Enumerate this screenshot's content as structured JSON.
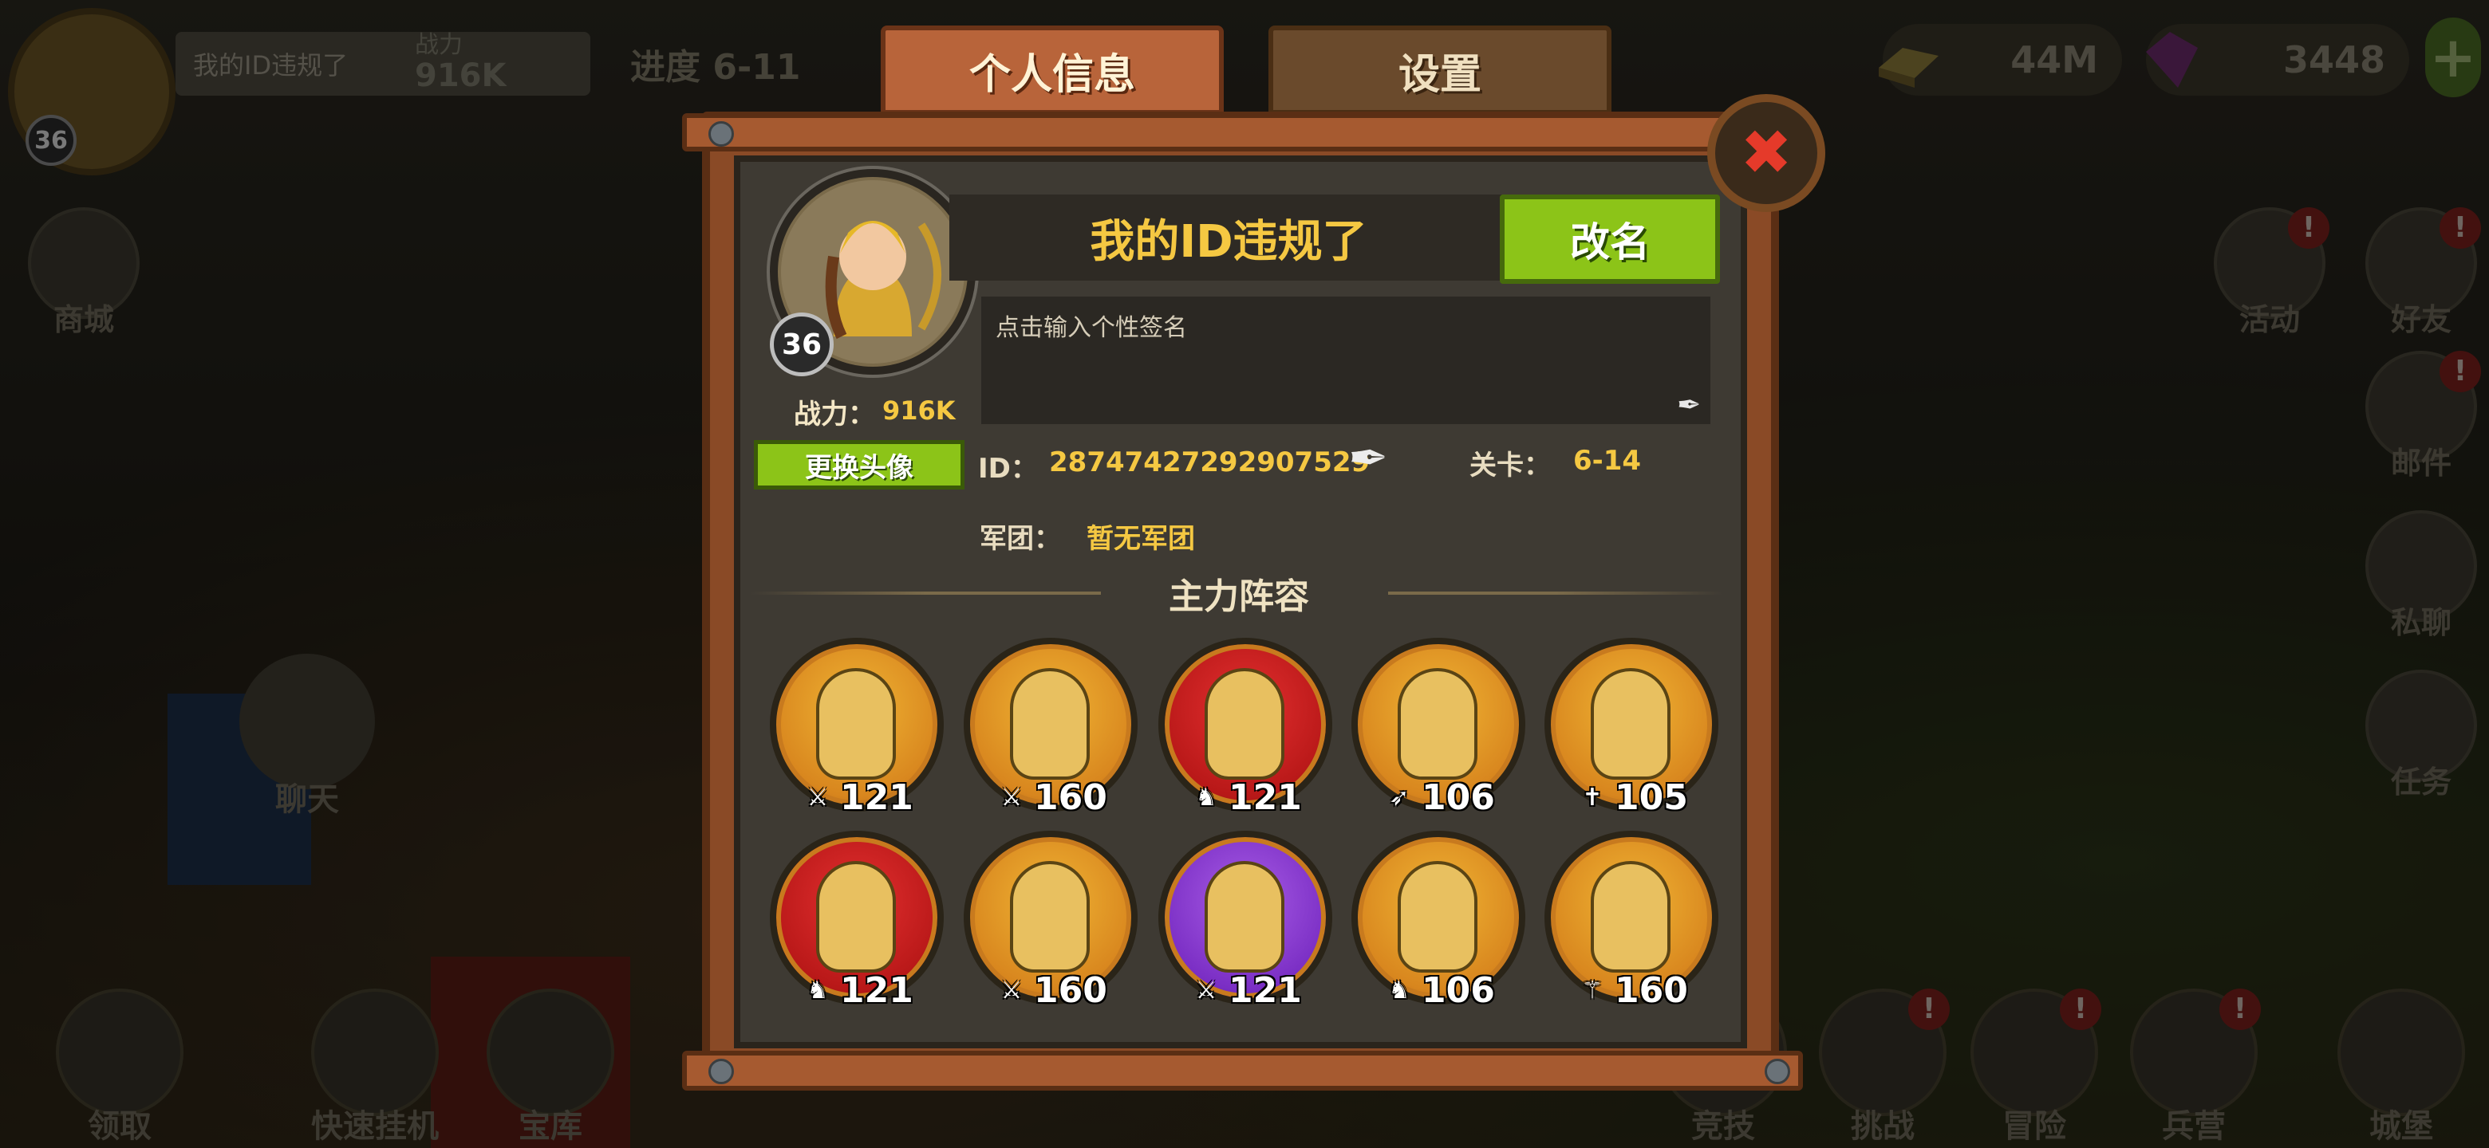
{
  "hud": {
    "player_name": "我的ID违规了",
    "player_level": "36",
    "power_label": "战力",
    "power_value": "916K",
    "progress_label": "进度",
    "progress_value": "6-11",
    "gold": "44M",
    "gems": "3448",
    "plus": "+"
  },
  "left_buttons": {
    "shop": "商城",
    "chat": "聊天",
    "claim": "领取",
    "quick_idle": "快速挂机",
    "treasury": "宝库"
  },
  "right_buttons": {
    "activity": "活动",
    "friends": "好友",
    "mail": "邮件",
    "pm": "私聊",
    "tasks": "任务",
    "badge": "!"
  },
  "bottom_buttons": {
    "arena": "竞技",
    "challenge": "挑战",
    "adventure": "冒险",
    "barracks": "兵营",
    "castle": "城堡"
  },
  "tabs": {
    "profile": "个人信息",
    "settings": "设置"
  },
  "close_icon": "✖",
  "profile": {
    "name": "我的ID违规了",
    "level": "36",
    "rename_button": "改名",
    "signature_placeholder": "点击输入个性签名",
    "power_label": "战力：",
    "power_value": "916K",
    "change_avatar_button": "更换头像",
    "id_label": "ID：",
    "id_value": "2874742729290752­9",
    "stage_label": "关卡：",
    "stage_value": "6-14",
    "legion_label": "军团：",
    "legion_value": "暂无军团"
  },
  "lineup": {
    "title": "主力阵容",
    "heroes": [
      {
        "frame": "gold",
        "class_icon": "sword-icon",
        "level": "121"
      },
      {
        "frame": "gold",
        "class_icon": "sword-icon",
        "level": "160"
      },
      {
        "frame": "red",
        "class_icon": "horse-icon",
        "level": "121"
      },
      {
        "frame": "gold",
        "class_icon": "bow-icon",
        "level": "106"
      },
      {
        "frame": "gold",
        "class_icon": "cross-icon",
        "level": "105"
      },
      {
        "frame": "red",
        "class_icon": "horse-icon",
        "level": "121"
      },
      {
        "frame": "gold",
        "class_icon": "sword-icon",
        "level": "160"
      },
      {
        "frame": "purple",
        "class_icon": "sword-icon",
        "level": "121"
      },
      {
        "frame": "gold",
        "class_icon": "horse-icon",
        "level": "106"
      },
      {
        "frame": "gold",
        "class_icon": "staff-icon",
        "level": "160"
      }
    ]
  }
}
